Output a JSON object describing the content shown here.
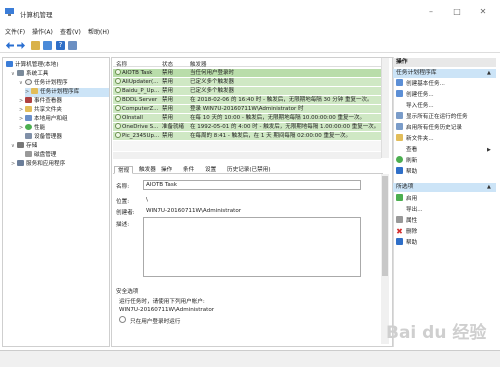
{
  "window": {
    "title": "计算机管理",
    "buttons": [
      "–",
      "□",
      "✕"
    ]
  },
  "menu": [
    "文件(F)",
    "操作(A)",
    "查看(V)",
    "帮助(H)"
  ],
  "tree": [
    {
      "label": "计算机管理(本地)",
      "indent": 0,
      "arrow": ""
    },
    {
      "label": "系统工具",
      "indent": 1,
      "arrow": "∨"
    },
    {
      "label": "任务计划程序",
      "indent": 2,
      "arrow": "∨"
    },
    {
      "label": "任务计划程序库",
      "indent": 3,
      "arrow": ">"
    },
    {
      "label": "事件查看器",
      "indent": 2,
      "arrow": ">"
    },
    {
      "label": "共享文件夹",
      "indent": 2,
      "arrow": ">"
    },
    {
      "label": "本地用户和组",
      "indent": 2,
      "arrow": ">"
    },
    {
      "label": "性能",
      "indent": 2,
      "arrow": ">"
    },
    {
      "label": "设备管理器",
      "indent": 2,
      "arrow": ""
    },
    {
      "label": "存储",
      "indent": 1,
      "arrow": "∨"
    },
    {
      "label": "磁盘管理",
      "indent": 2,
      "arrow": ""
    },
    {
      "label": "服务和应用程序",
      "indent": 1,
      "arrow": ">"
    }
  ],
  "table": {
    "headers": [
      "名称",
      "状态",
      "触发器"
    ],
    "rows": [
      {
        "name": "AIOTB Task",
        "status": "禁用",
        "trigger": "当任何用户登录时"
      },
      {
        "name": "AliUpdater(...",
        "status": "禁用",
        "trigger": "已定义多个触发器"
      },
      {
        "name": "Baidu_P_Up...",
        "status": "禁用",
        "trigger": "已定义多个触发器"
      },
      {
        "name": "BDDL Server",
        "status": "禁用",
        "trigger": "在 2018-02-06 的 16:40 时 - 触发后，无限期地每隔 30 分钟 重复一次。"
      },
      {
        "name": "ComputerZ...",
        "status": "禁用",
        "trigger": "登录 WIN7U-20160711W\\Administrator 时"
      },
      {
        "name": "OInstall",
        "status": "禁用",
        "trigger": "在每 10 天的 10:00 - 触发后，无限期地每隔 10.00:00:00 重复一次。"
      },
      {
        "name": "OneDrive S...",
        "status": "准备就绪",
        "trigger": "在 1992-05-01 的 4:00 时 - 触发后，无限期地每隔 1.00:00:00 重复一次。"
      },
      {
        "name": "Pic_2345Up...",
        "status": "禁用",
        "trigger": "在每周的 8:41 - 触发后，在 1 天 期间每隔 02:00:00 重复一次。"
      }
    ]
  },
  "detail": {
    "tabs": [
      "常规",
      "触发器",
      "操作",
      "条件",
      "设置",
      "历史记录(已禁用)"
    ],
    "name_label": "名称:",
    "name_value": "AIOTB Task",
    "location_label": "位置:",
    "location_value": "\\",
    "author_label": "创建者:",
    "author_value": "WIN7U-20160711W\\Administrator",
    "desc_label": "描述:",
    "security_title": "安全选项",
    "security_text": "运行任务时，请使用下列用户帐户:",
    "security_user": "WIN7U-20160711W\\Administrator",
    "radio_label": "只在用户登录时运行"
  },
  "actions": {
    "header": "操作",
    "group1": "任务计划程序库",
    "group1_items": [
      "创建基本任务...",
      "创建任务...",
      "导入任务...",
      "显示所有正在运行的任务",
      "启用所有任务历史记录",
      "新文件夹...",
      "查看",
      "刷新",
      "帮助"
    ],
    "group2": "所选项",
    "group2_items": [
      "启用",
      "导出...",
      "属性",
      "删除",
      "帮助"
    ]
  },
  "watermark": "Bai du 经验"
}
